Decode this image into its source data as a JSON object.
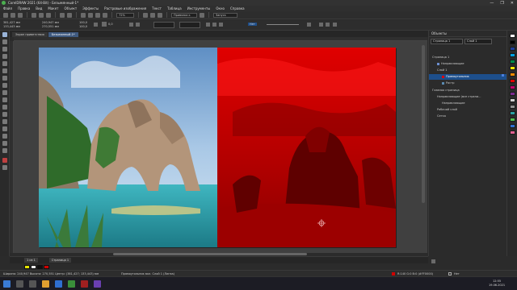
{
  "window": {
    "title": "CorelDRAW 2021 (64-Bit) - Безымянный-1*",
    "controls": [
      "—",
      "❐",
      "✕"
    ]
  },
  "menu": [
    "Файл",
    "Правка",
    "Вид",
    "Макет",
    "Объект",
    "Эффекты",
    "Растровые изображения",
    "Текст",
    "Таблица",
    "Инструменты",
    "Окно",
    "Справка"
  ],
  "toolbar": {
    "zoom": "72%",
    "snap": "Привязка к",
    "launch": "Запуск"
  },
  "propertybar": {
    "x": "381,427 мм",
    "y": "133,443 мм",
    "w": "240,947 мм",
    "h": "270,551 мм",
    "scale_w": "100,0",
    "scale_h": "100,0",
    "angle": "0,0",
    "mode": "Нет"
  },
  "doc_tabs": [
    "Экран приветствия",
    "Безымянный-1*"
  ],
  "objects_docker": {
    "title": "Объекты",
    "page_select": "Страница 1",
    "layer_select": "Слой 1",
    "rows": [
      {
        "label": "Страница 1",
        "level": 0
      },
      {
        "label": "Направляющие",
        "level": 1
      },
      {
        "label": "Слой 1",
        "level": 1
      },
      {
        "label": "Прямоугольник",
        "level": 2,
        "selected": true
      },
      {
        "label": "Растр",
        "level": 2
      },
      {
        "label": "Главная страница",
        "level": 0
      },
      {
        "label": "Направляющие (все страни...",
        "level": 1
      },
      {
        "label": "Направляющие",
        "level": 2
      },
      {
        "label": "Рабочий слой",
        "level": 1
      },
      {
        "label": "Сетка",
        "level": 1
      }
    ]
  },
  "page_tabs": {
    "counter": "1 из 1",
    "tab": "Страница 1"
  },
  "status": {
    "left": "Ширина: 240,947 Высота: 270,551 Центр: (381,427; 133,443) мм",
    "center": "Прямоугольник вкл. Слой 1 (Линза)",
    "fill": "R:140 G:0 B:0 (#FF0000)",
    "outline": "Нет"
  },
  "tray": {
    "time": "12:55",
    "date": "19.06.2021"
  },
  "colors": {
    "accent": "#1d4f8c",
    "red_lens": "#d00000"
  }
}
